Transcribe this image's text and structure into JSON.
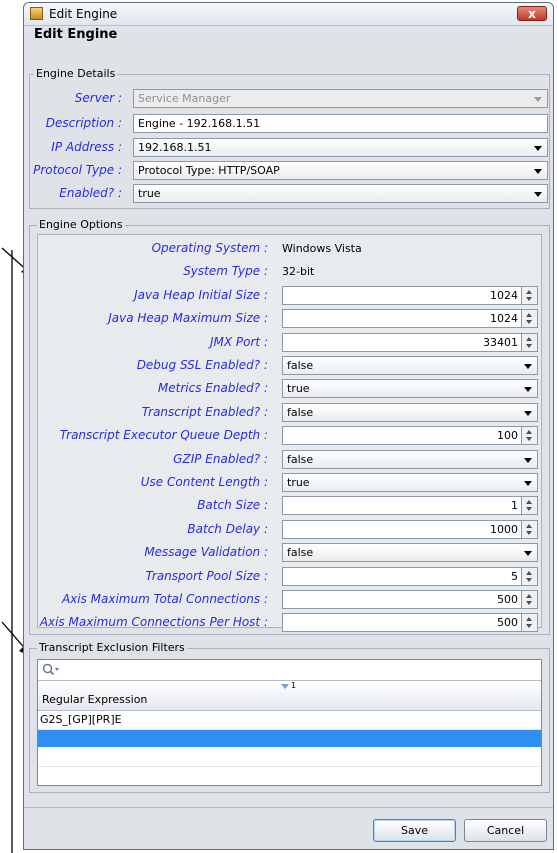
{
  "window": {
    "title": "Edit Engine",
    "close_symbol": "x"
  },
  "dialog": {
    "heading": "Edit Engine"
  },
  "engine_details": {
    "group_title": "Engine Details",
    "fields": [
      {
        "label": "Server :",
        "value": "Service Manager"
      },
      {
        "label": "Description :",
        "value": "Engine - 192.168.1.51"
      },
      {
        "label": "IP Address :",
        "value": "192.168.1.51"
      },
      {
        "label": "Protocol Type :",
        "value": "Protocol Type: HTTP/SOAP"
      },
      {
        "label": "Enabled? :",
        "value": "true"
      }
    ]
  },
  "engine_options": {
    "group_title": "Engine Options",
    "rows": [
      {
        "label": "Operating System :",
        "value": "Windows Vista"
      },
      {
        "label": "System Type :",
        "value": "32-bit"
      },
      {
        "label": "Java Heap Initial Size :",
        "value": "1024"
      },
      {
        "label": "Java Heap Maximum Size :",
        "value": "1024"
      },
      {
        "label": "JMX Port :",
        "value": "33401"
      },
      {
        "label": "Debug SSL Enabled? :",
        "value": "false"
      },
      {
        "label": "Metrics Enabled? :",
        "value": "true"
      },
      {
        "label": "Transcript Enabled? :",
        "value": "false"
      },
      {
        "label": "Transcript Executor Queue Depth :",
        "value": "100"
      },
      {
        "label": "GZIP Enabled? :",
        "value": "false"
      },
      {
        "label": "Use Content Length :",
        "value": "true"
      },
      {
        "label": "Batch Size :",
        "value": "1"
      },
      {
        "label": "Batch Delay :",
        "value": "1000"
      },
      {
        "label": "Message Validation :",
        "value": "false"
      },
      {
        "label": "Transport Pool Size :",
        "value": "5"
      },
      {
        "label": "Axis Maximum Total Connections :",
        "value": "500"
      },
      {
        "label": "Axis Maximum Connections Per Host :",
        "value": "500"
      }
    ]
  },
  "exclusion_filters": {
    "group_title": "Transcript Exclusion Filters",
    "search_icon_name": "search-icon",
    "column_header": "Regular Expression",
    "sort_indicator": "1",
    "rows": [
      "G2S_[GP][PR]E",
      ""
    ]
  },
  "buttons": {
    "save": "Save",
    "cancel": "Cancel"
  },
  "colors": {
    "label_blue": "#2a2ae0",
    "selection_blue": "#2f8ef0"
  }
}
